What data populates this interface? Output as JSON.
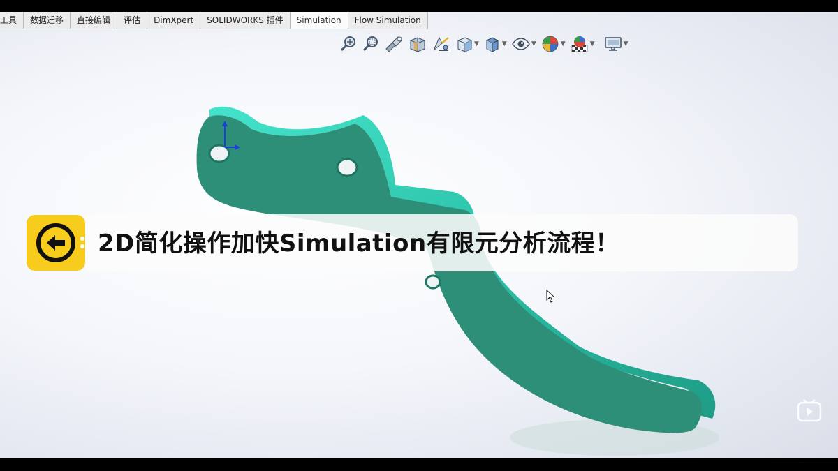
{
  "tabs": [
    {
      "label": "工具",
      "active": false
    },
    {
      "label": "数据迁移",
      "active": false
    },
    {
      "label": "直接编辑",
      "active": false
    },
    {
      "label": "评估",
      "active": false
    },
    {
      "label": "DimXpert",
      "active": false
    },
    {
      "label": "SOLIDWORKS 插件",
      "active": false
    },
    {
      "label": "Simulation",
      "active": true
    },
    {
      "label": "Flow Simulation",
      "active": false
    }
  ],
  "view_toolbar": [
    {
      "icon": "zoom-to-fit-icon",
      "dropdown": false
    },
    {
      "icon": "zoom-to-area-icon",
      "dropdown": false
    },
    {
      "icon": "previous-view-icon",
      "dropdown": false
    },
    {
      "icon": "section-view-icon",
      "dropdown": false
    },
    {
      "icon": "dynamic-annotation-views-icon",
      "dropdown": false
    },
    {
      "icon": "view-orientation-icon",
      "dropdown": true
    },
    {
      "icon": "display-style-icon",
      "dropdown": true
    },
    {
      "icon": "hide-show-items-icon",
      "dropdown": true
    },
    {
      "icon": "edit-appearance-icon",
      "dropdown": true
    },
    {
      "icon": "apply-scene-icon",
      "dropdown": true
    },
    {
      "icon": "view-settings-icon",
      "dropdown": true
    }
  ],
  "banner": {
    "text": "2D简化操作加快Simulation有限元分析流程！",
    "badge_icon": "back-arrow-icon",
    "badge_color": "#f7cc1c"
  },
  "model": {
    "color": "#2e8f78",
    "edge_color": "#3fd9c2"
  },
  "watermark_icon": "video-play-icon"
}
